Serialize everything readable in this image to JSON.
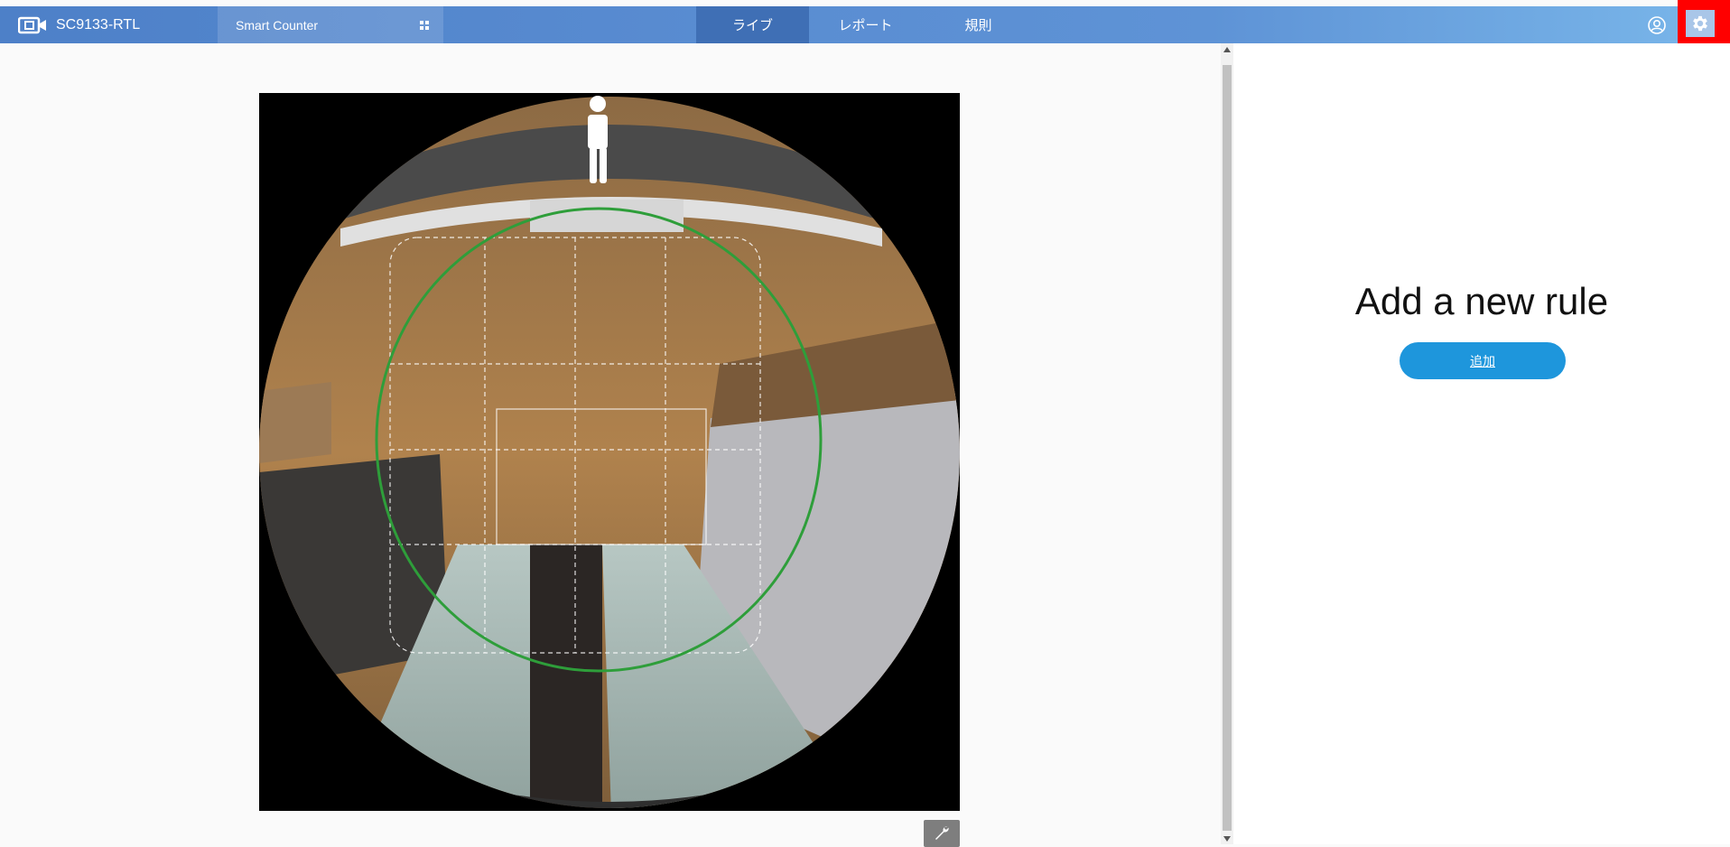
{
  "header": {
    "device_name": "SC9133-RTL",
    "app_name": "Smart Counter",
    "tabs": [
      {
        "label": "ライブ",
        "active": true
      },
      {
        "label": "レポート",
        "active": false
      },
      {
        "label": "規則",
        "active": false
      }
    ],
    "icons": {
      "logo": "camera-logo-icon",
      "app_switch": "grid-icon",
      "user": "user-circle-icon",
      "settings": "gear-icon"
    },
    "colors": {
      "bar_start": "#4d80c8",
      "bar_end": "#7ab7ea",
      "active_tab": "#3f6fb5",
      "settings_highlight": "#ff0000"
    }
  },
  "live_view": {
    "detection_circle_color": "#2e9e3a",
    "tool_icon": "wrench-icon"
  },
  "rule_panel": {
    "title": "Add a new rule",
    "add_label": "追加",
    "button_color": "#1e96dc"
  }
}
